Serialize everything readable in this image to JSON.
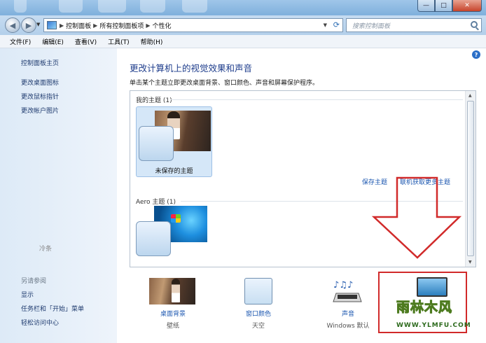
{
  "window": {
    "controls": {
      "min": "—",
      "max": "□",
      "close": "✕"
    }
  },
  "address": {
    "crumbs": [
      "控制面板",
      "所有控制面板项",
      "个性化"
    ],
    "search_placeholder": "搜索控制面板"
  },
  "menu": [
    "文件(F)",
    "编辑(E)",
    "查看(V)",
    "工具(T)",
    "帮助(H)"
  ],
  "sidebar": {
    "home": "控制面板主页",
    "links": [
      "更改桌面图标",
      "更改鼠标指针",
      "更改帐户图片"
    ],
    "stray": "冷条",
    "see_also_heading": "另请参阅",
    "see_also": [
      "显示",
      "任务栏和「开始」菜单",
      "轻松访问中心"
    ]
  },
  "main": {
    "title": "更改计算机上的视觉效果和声音",
    "subtitle": "单击某个主题立即更改桌面背景、窗口颜色、声音和屏幕保护程序。",
    "my_themes_label": "我的主题 (1)",
    "unsaved_theme": "未保存的主题",
    "save_theme": "保存主题",
    "get_more_themes": "联机获取更多主题",
    "aero_label": "Aero 主题 (1)",
    "help": "?"
  },
  "bottom": [
    {
      "label": "桌面背景",
      "sub": "壁纸"
    },
    {
      "label": "窗口颜色",
      "sub": "天空"
    },
    {
      "label": "声音",
      "sub": "Windows 默认"
    }
  ],
  "watermark": {
    "text": "雨林木风",
    "url": "WWW.YLMFU.COM"
  },
  "colors": {
    "link": "#1c57b0",
    "title": "#1e3d8c",
    "highlight_red": "#d12a2a"
  }
}
